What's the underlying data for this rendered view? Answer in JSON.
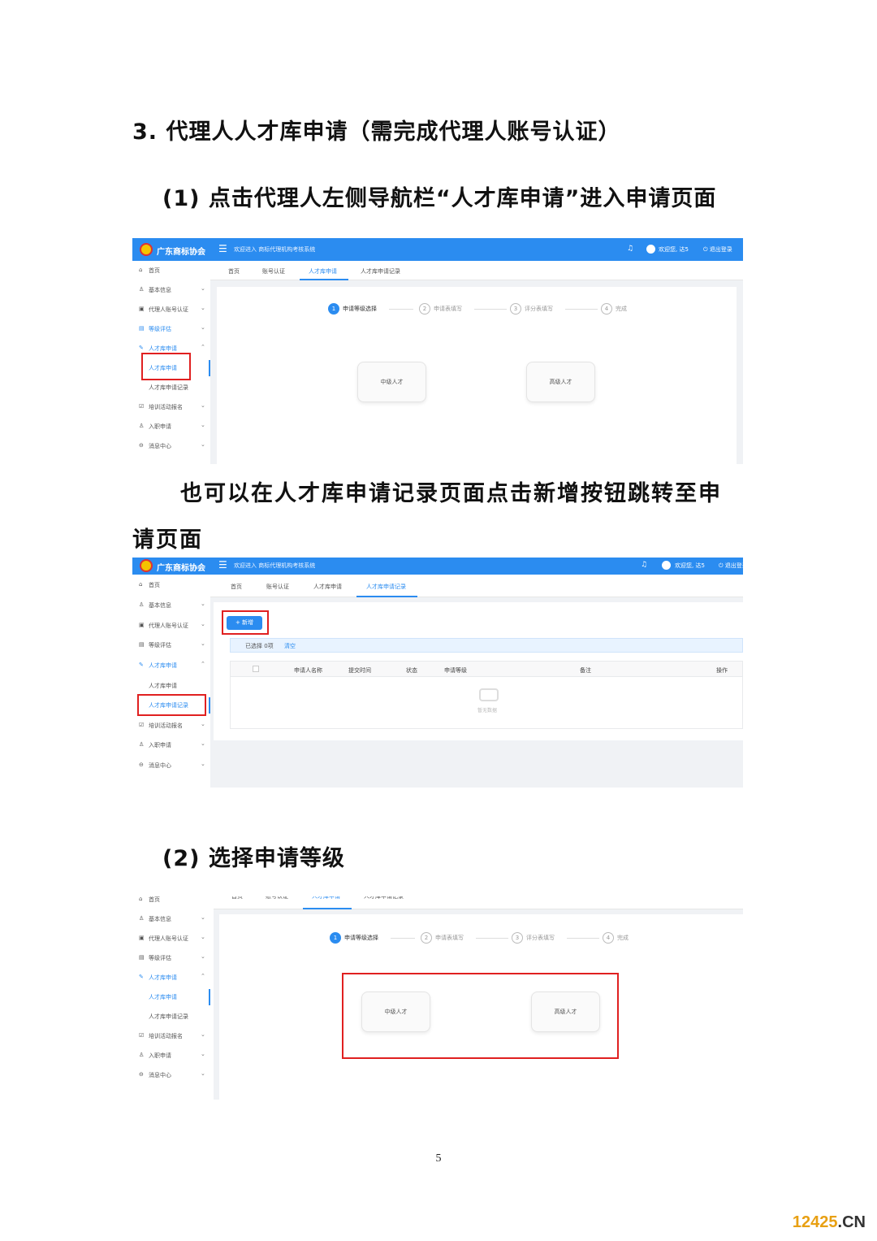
{
  "doc": {
    "section_heading": "3. 代理人人才库申请（需完成代理人账号认证）",
    "step1_heading": "(1) 点击代理人左侧导航栏“人才库申请”进入申请页面",
    "paragraph_line1": "也可以在人才库申请记录页面点击新增按钮跳转至申",
    "paragraph_line2": "请页面",
    "step2_heading": "(2) 选择申请等级",
    "page_number": "5",
    "watermark_num": "12425",
    "watermark_domain": ".CN"
  },
  "app": {
    "brand": "广东商标协会",
    "welcome_system": "欢迎进入 商标代理机构考核系统",
    "user_greeting": "欢迎您, 达5",
    "logout": "退出登录",
    "accent_color": "#2b8cf0",
    "highlight_color": "#e02020",
    "sidebar": {
      "home": "首页",
      "basic_info": "基本信息",
      "agent_cert": "代理人账号认证",
      "rating": "等级评估",
      "talent_apply_group": "人才库申请",
      "talent_apply": "人才库申请",
      "talent_apply_record": "人才库申请记录",
      "training": "培训活动报名",
      "onboarding": "入职申请",
      "messages": "消息中心"
    },
    "tabs": {
      "home": "首页",
      "account_cert": "账号认证",
      "talent_apply": "人才库申请",
      "talent_record": "人才库申请记录"
    },
    "steps": [
      {
        "num": "1",
        "label": "申请等级选择"
      },
      {
        "num": "2",
        "label": "申请表填写"
      },
      {
        "num": "3",
        "label": "评分表填写"
      },
      {
        "num": "4",
        "label": "完成"
      }
    ],
    "levels": {
      "mid": "中级人才",
      "senior": "高级人才"
    },
    "record_page": {
      "add_button": "+ 新增",
      "selected": "已选择 0项",
      "clear": "清空",
      "columns": [
        "申请人名称",
        "提交时间",
        "状态",
        "申请等级",
        "备注",
        "操作"
      ],
      "empty": "暂无数据"
    }
  }
}
